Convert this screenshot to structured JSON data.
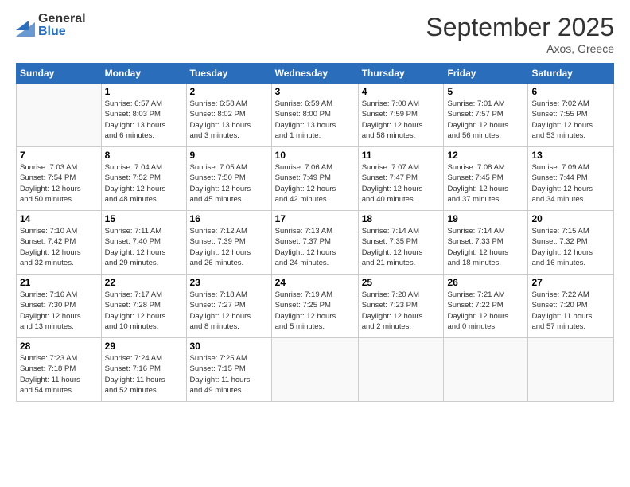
{
  "logo": {
    "general": "General",
    "blue": "Blue"
  },
  "title": "September 2025",
  "location": "Axos, Greece",
  "days_of_week": [
    "Sunday",
    "Monday",
    "Tuesday",
    "Wednesday",
    "Thursday",
    "Friday",
    "Saturday"
  ],
  "weeks": [
    [
      {
        "day": "",
        "info": ""
      },
      {
        "day": "1",
        "info": "Sunrise: 6:57 AM\nSunset: 8:03 PM\nDaylight: 13 hours\nand 6 minutes."
      },
      {
        "day": "2",
        "info": "Sunrise: 6:58 AM\nSunset: 8:02 PM\nDaylight: 13 hours\nand 3 minutes."
      },
      {
        "day": "3",
        "info": "Sunrise: 6:59 AM\nSunset: 8:00 PM\nDaylight: 13 hours\nand 1 minute."
      },
      {
        "day": "4",
        "info": "Sunrise: 7:00 AM\nSunset: 7:59 PM\nDaylight: 12 hours\nand 58 minutes."
      },
      {
        "day": "5",
        "info": "Sunrise: 7:01 AM\nSunset: 7:57 PM\nDaylight: 12 hours\nand 56 minutes."
      },
      {
        "day": "6",
        "info": "Sunrise: 7:02 AM\nSunset: 7:55 PM\nDaylight: 12 hours\nand 53 minutes."
      }
    ],
    [
      {
        "day": "7",
        "info": "Sunrise: 7:03 AM\nSunset: 7:54 PM\nDaylight: 12 hours\nand 50 minutes."
      },
      {
        "day": "8",
        "info": "Sunrise: 7:04 AM\nSunset: 7:52 PM\nDaylight: 12 hours\nand 48 minutes."
      },
      {
        "day": "9",
        "info": "Sunrise: 7:05 AM\nSunset: 7:50 PM\nDaylight: 12 hours\nand 45 minutes."
      },
      {
        "day": "10",
        "info": "Sunrise: 7:06 AM\nSunset: 7:49 PM\nDaylight: 12 hours\nand 42 minutes."
      },
      {
        "day": "11",
        "info": "Sunrise: 7:07 AM\nSunset: 7:47 PM\nDaylight: 12 hours\nand 40 minutes."
      },
      {
        "day": "12",
        "info": "Sunrise: 7:08 AM\nSunset: 7:45 PM\nDaylight: 12 hours\nand 37 minutes."
      },
      {
        "day": "13",
        "info": "Sunrise: 7:09 AM\nSunset: 7:44 PM\nDaylight: 12 hours\nand 34 minutes."
      }
    ],
    [
      {
        "day": "14",
        "info": "Sunrise: 7:10 AM\nSunset: 7:42 PM\nDaylight: 12 hours\nand 32 minutes."
      },
      {
        "day": "15",
        "info": "Sunrise: 7:11 AM\nSunset: 7:40 PM\nDaylight: 12 hours\nand 29 minutes."
      },
      {
        "day": "16",
        "info": "Sunrise: 7:12 AM\nSunset: 7:39 PM\nDaylight: 12 hours\nand 26 minutes."
      },
      {
        "day": "17",
        "info": "Sunrise: 7:13 AM\nSunset: 7:37 PM\nDaylight: 12 hours\nand 24 minutes."
      },
      {
        "day": "18",
        "info": "Sunrise: 7:14 AM\nSunset: 7:35 PM\nDaylight: 12 hours\nand 21 minutes."
      },
      {
        "day": "19",
        "info": "Sunrise: 7:14 AM\nSunset: 7:33 PM\nDaylight: 12 hours\nand 18 minutes."
      },
      {
        "day": "20",
        "info": "Sunrise: 7:15 AM\nSunset: 7:32 PM\nDaylight: 12 hours\nand 16 minutes."
      }
    ],
    [
      {
        "day": "21",
        "info": "Sunrise: 7:16 AM\nSunset: 7:30 PM\nDaylight: 12 hours\nand 13 minutes."
      },
      {
        "day": "22",
        "info": "Sunrise: 7:17 AM\nSunset: 7:28 PM\nDaylight: 12 hours\nand 10 minutes."
      },
      {
        "day": "23",
        "info": "Sunrise: 7:18 AM\nSunset: 7:27 PM\nDaylight: 12 hours\nand 8 minutes."
      },
      {
        "day": "24",
        "info": "Sunrise: 7:19 AM\nSunset: 7:25 PM\nDaylight: 12 hours\nand 5 minutes."
      },
      {
        "day": "25",
        "info": "Sunrise: 7:20 AM\nSunset: 7:23 PM\nDaylight: 12 hours\nand 2 minutes."
      },
      {
        "day": "26",
        "info": "Sunrise: 7:21 AM\nSunset: 7:22 PM\nDaylight: 12 hours\nand 0 minutes."
      },
      {
        "day": "27",
        "info": "Sunrise: 7:22 AM\nSunset: 7:20 PM\nDaylight: 11 hours\nand 57 minutes."
      }
    ],
    [
      {
        "day": "28",
        "info": "Sunrise: 7:23 AM\nSunset: 7:18 PM\nDaylight: 11 hours\nand 54 minutes."
      },
      {
        "day": "29",
        "info": "Sunrise: 7:24 AM\nSunset: 7:16 PM\nDaylight: 11 hours\nand 52 minutes."
      },
      {
        "day": "30",
        "info": "Sunrise: 7:25 AM\nSunset: 7:15 PM\nDaylight: 11 hours\nand 49 minutes."
      },
      {
        "day": "",
        "info": ""
      },
      {
        "day": "",
        "info": ""
      },
      {
        "day": "",
        "info": ""
      },
      {
        "day": "",
        "info": ""
      }
    ]
  ]
}
